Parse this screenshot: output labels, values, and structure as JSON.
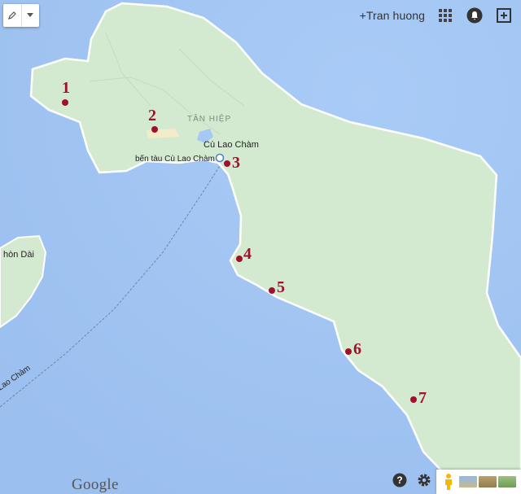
{
  "toolbar": {
    "draw_icon": "pencil-icon",
    "dropdown_icon": "caret-down-icon"
  },
  "header": {
    "user_link": "+Tran huong",
    "apps_icon": "grid-icon",
    "notifications_icon": "bell-icon",
    "share_icon": "plus-box-icon"
  },
  "map": {
    "places": {
      "district": "TÂN HIỆP",
      "island": "Cù Lao Chàm",
      "pier": "bến tàu Cù Lao Chàm",
      "west_island": "hòn Dài",
      "ferry_route": "Lao Chàm"
    },
    "markers": [
      "1",
      "2",
      "3",
      "4",
      "5",
      "6",
      "7"
    ],
    "colors": {
      "water": "#a5c8f4",
      "land": "#d4ead0",
      "marker": "#a0102a"
    }
  },
  "footer": {
    "brand": "Google",
    "help_icon": "question-circle-icon",
    "settings_icon": "gear-icon",
    "pegman_icon": "pegman-icon"
  }
}
